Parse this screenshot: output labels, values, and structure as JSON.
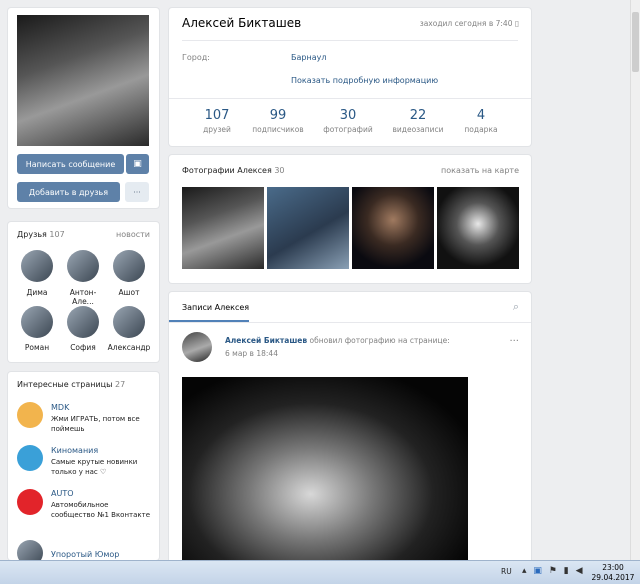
{
  "profile": {
    "name": "Алексей Бикташев",
    "last_seen": "заходил сегодня в 7:40",
    "city_label": "Город:",
    "city_value": "Барнаул",
    "more_info": "Показать подробную информацию",
    "message_btn": "Написать сообщение",
    "add_friend_btn": "Добавить в друзья",
    "more_btn": "···"
  },
  "stats": [
    {
      "num": "107",
      "label": "друзей"
    },
    {
      "num": "99",
      "label": "подписчиков"
    },
    {
      "num": "30",
      "label": "фотографий"
    },
    {
      "num": "22",
      "label": "видеозаписи"
    },
    {
      "num": "4",
      "label": "подарка"
    }
  ],
  "friends": {
    "title": "Друзья",
    "count": "107",
    "link": "новости",
    "items": [
      "Дима",
      "Антон-Але...",
      "Ашот",
      "Роман",
      "София",
      "Александр"
    ]
  },
  "pages": {
    "title": "Интересные страницы",
    "count": "27",
    "items": [
      {
        "name": "MDK",
        "desc": "Жми ИГРАТЬ, потом все поймешь"
      },
      {
        "name": "Киномания",
        "desc": "Самые крутые новинки только у нас ♡"
      },
      {
        "name": "AUTO",
        "desc": "Автомобильное сообщество №1 Вконтакте"
      },
      {
        "name": "Упоротый Юмор",
        "desc": ""
      }
    ]
  },
  "photos": {
    "title": "Фотографии Алексея",
    "count": "30",
    "map_link": "показать на карте"
  },
  "wall": {
    "title": "Записи Алексея",
    "post_author": "Алексей Бикташев",
    "post_action": "обновил фотографию на странице:",
    "post_date": "6 мар в 18:44",
    "post_menu": "···"
  },
  "taskbar": {
    "lang": "RU",
    "time": "23:00",
    "date": "29.04.2017"
  }
}
